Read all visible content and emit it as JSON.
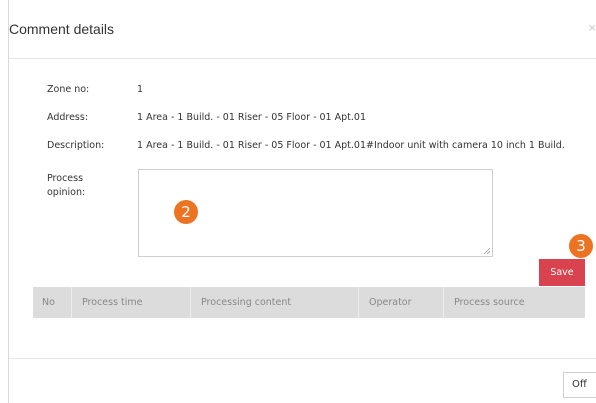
{
  "dialog": {
    "title": "Comment details",
    "close_glyph": "×"
  },
  "fields": {
    "zone_label": "Zone no:",
    "zone_value": "1",
    "address_label": "Address:",
    "address_value": "1 Area - 1 Build. - 01 Riser - 05 Floor - 01 Apt.01",
    "description_label": "Description:",
    "description_value": "1 Area - 1 Build. - 01 Riser - 05 Floor - 01 Apt.01#Indoor unit with camera 10 inch 1 Build.",
    "process_opinion_label_line1": "Process",
    "process_opinion_label_line2": "opinion:",
    "process_opinion_value": ""
  },
  "markers": {
    "opinion_step": "2",
    "save_step": "3",
    "color": "#ec7322"
  },
  "actions": {
    "save_label": "Save",
    "off_label": "Off"
  },
  "table": {
    "columns": [
      "No",
      "Process time",
      "Processing content",
      "Operator",
      "Process source"
    ],
    "rows": []
  },
  "colors": {
    "save_button": "#d9434f",
    "table_header_bg": "#dcdcdc"
  }
}
